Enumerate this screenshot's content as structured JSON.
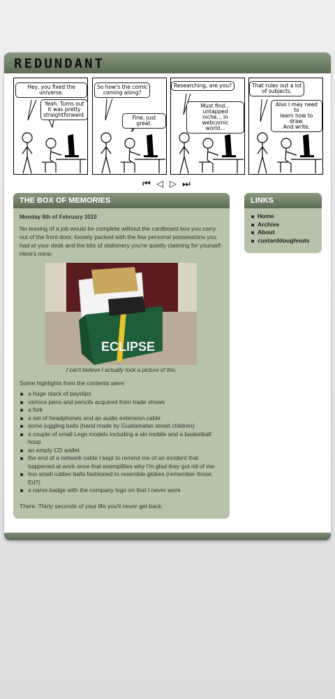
{
  "site": {
    "title": "REDUNDANT"
  },
  "comic": {
    "bubbles": [
      "Hey, you fixed the universe.",
      "Yeah. Turns out\nit was pretty\nstraightforward.",
      "So how's the comic\ncoming along?",
      "Fine, just great.",
      "Researching, are you?",
      "Must find... untapped\nniche... in webcomic\nworld...",
      "That rules out a lot\nof subjects.",
      "Also I may need to\nlearn how to draw.\nAnd write."
    ],
    "nav": {
      "first": "⏮",
      "prev": "◁",
      "next": "▷",
      "last": "⏭"
    }
  },
  "post": {
    "heading": "THE BOX OF MEMORIES",
    "date": "Monday 8th of February 2010",
    "intro": "No leaving of a job would be complete without the cardboard box you carry out of the front door, loosely packed with the few personal possessions you had at your desk and the bits of stationery you're quietly claiming for yourself. Here's mine:",
    "photo_box_text": "ECLIPSE",
    "caption": "I can't believe I actually took a picture of this.",
    "highlights_intro": "Some highlights from the contents were:",
    "highlights": [
      "a huge stack of payslips",
      "various pens and pencils acquired from trade shows",
      "a fork",
      "a set of headphones and an audio extension cable",
      "some juggling balls (hand made by Guatamalan street children)",
      "a couple of small Lego models including a ski-mobile and a basketball hoop",
      "an empty CD wallet",
      "the end of a network cable I kept to remind me of an incident that happened at work once that exemplifies why I'm glad they got rid of me",
      "two small rubber balls fashioned to resemble globes (remember those, Ed?)",
      "a name badge with the company logo on that I never wore"
    ],
    "outro": "There. Thirty seconds of your life you'll never get back."
  },
  "links": {
    "heading": "LINKS",
    "items": [
      "Home",
      "Archive",
      "About",
      "custarddoughnuts"
    ]
  },
  "colors": {
    "accent": "#5c6b54",
    "box": "#b6c2a9"
  }
}
